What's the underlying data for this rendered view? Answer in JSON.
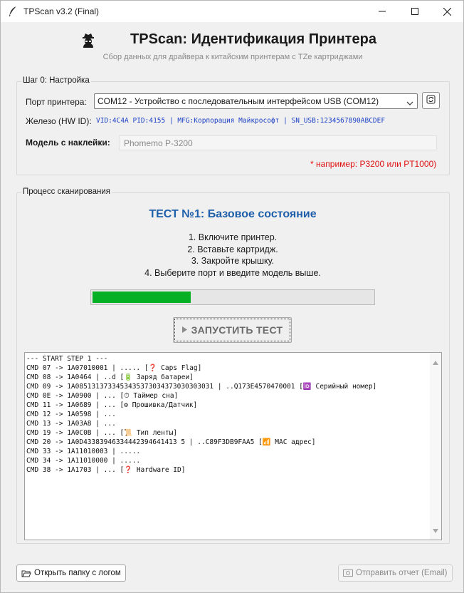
{
  "window": {
    "title": "TPScan v3.2 (Final)"
  },
  "header": {
    "title": "TPScan: Идентификация Принтера",
    "subtitle": "Сбор данных для драйвера к китайским принтерам с TZe картриджами"
  },
  "settings": {
    "group_label": "Шаг 0: Настройка",
    "port_label": "Порт принтера:",
    "port_value": "COM12 - Устройство с последовательным интерфейсом USB (COM12)",
    "hwid_label": "Железо (HW ID):",
    "hwid_value": "VID:4C4A PID:4155 | MFG:Корпорация Майкрософт | SN_USB:1234567890ABCDEF",
    "model_label": "Модель с наклейки:",
    "model_value": "Phomemo P-3200",
    "model_hint": "* например: P3200 или PT1000)"
  },
  "scan": {
    "group_label": "Процесс сканирования",
    "test_title": "ТЕСТ №1: Базовое состояние",
    "steps": [
      "1. Включите принтер.",
      "2. Вставьте картридж.",
      "3. Закройте крышку.",
      "4. Выберите порт и введите модель выше."
    ],
    "progress_fraction": 0.35,
    "run_button": "ЗАПУСТИТЬ ТЕСТ",
    "log": [
      "--- START STEP 1 ---",
      "CMD 07 -> 1A07010001 | ..... [❓ Caps Flag]",
      "CMD 08 -> 1A0464 | ..d [🔋 Заряд батареи]",
      "CMD 09 -> 1A0851313733453435373034373030303031 | ..Q173E4570470001 [🆔 Серийный номер]",
      "CMD 0E -> 1A0900 | ... [⏱ Таймер сна]",
      "CMD 11 -> 1A0689 | ... [⚙ Прошивка/Датчик]",
      "CMD 12 -> 1A0598 | ...",
      "CMD 13 -> 1A03A8 | ...",
      "CMD 19 -> 1A0C0B | ... [📜 Тип ленты]",
      "CMD 20 -> 1A0D43383946334442394641413 5 | ..C89F3DB9FAA5 [📶 MAC адрес]",
      "CMD 33 -> 1A11010003 | .....",
      "CMD 34 -> 1A11010000 | .....",
      "CMD 38 -> 1A1703 | ... [❓ Hardware ID]"
    ]
  },
  "footer": {
    "open_folder": "Открыть папку с логом",
    "send_report": "Отправить отчет (Email)"
  }
}
